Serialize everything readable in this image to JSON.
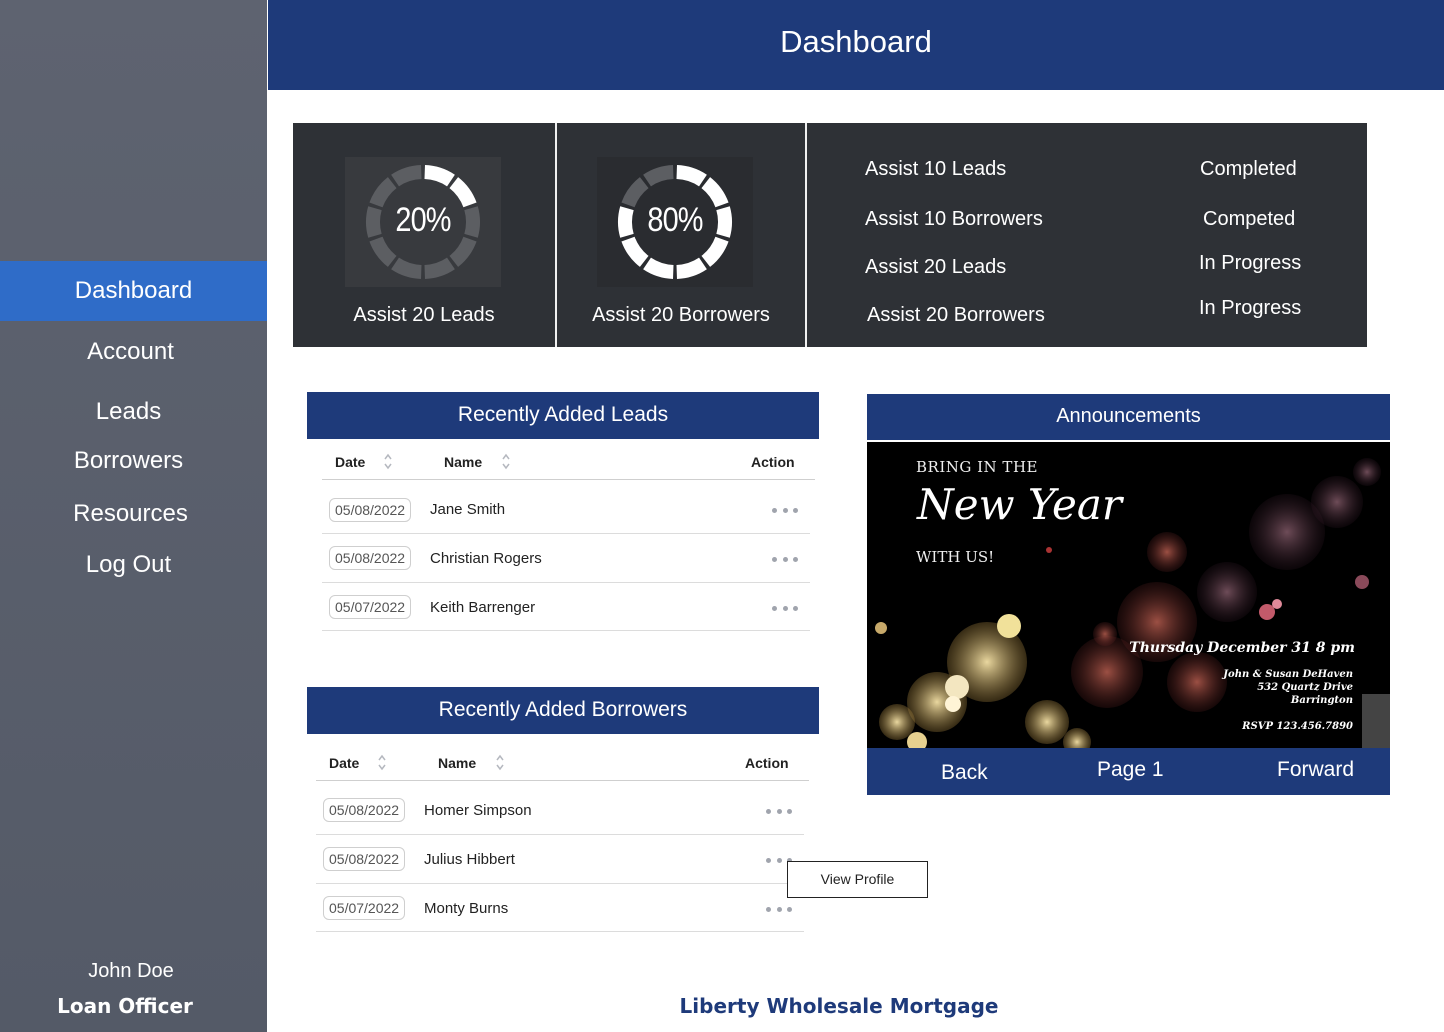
{
  "sidebar": {
    "items": [
      {
        "label": "Dashboard",
        "active": true
      },
      {
        "label": "Account"
      },
      {
        "label": "Leads"
      },
      {
        "label": "Borrowers"
      },
      {
        "label": "Resources"
      },
      {
        "label": "Log Out"
      }
    ],
    "user": {
      "name": "John Doe",
      "role": "Loan Officer"
    }
  },
  "header": {
    "title": "Dashboard"
  },
  "goals": {
    "rings": [
      {
        "percent": "20%",
        "value": 0.2,
        "label": "Assist 20 Leads"
      },
      {
        "percent": "80%",
        "value": 0.8,
        "label": "Assist 20 Borrowers"
      }
    ],
    "tasks": [
      {
        "name": "Assist 10 Leads",
        "status": "Completed"
      },
      {
        "name": "Assist 10 Borrowers",
        "status": "Competed"
      },
      {
        "name": "Assist 20 Leads",
        "status": "In Progress"
      },
      {
        "name": "Assist 20 Borrowers",
        "status": "In Progress"
      }
    ]
  },
  "leads_table": {
    "title": "Recently Added Leads",
    "columns": [
      "Date",
      "Name",
      "Action"
    ],
    "rows": [
      {
        "date": "05/08/2022",
        "name": "Jane Smith"
      },
      {
        "date": "05/08/2022",
        "name": "Christian Rogers"
      },
      {
        "date": "05/07/2022",
        "name": "Keith Barrenger"
      }
    ]
  },
  "borrowers_table": {
    "title": "Recently Added Borrowers",
    "columns": [
      "Date",
      "Name",
      "Action"
    ],
    "rows": [
      {
        "date": "05/08/2022",
        "name": "Homer Simpson"
      },
      {
        "date": "05/08/2022",
        "name": "Julius Hibbert"
      },
      {
        "date": "05/07/2022",
        "name": "Monty Burns"
      }
    ]
  },
  "context_menu": {
    "view_profile": "View Profile"
  },
  "announcements": {
    "title": "Announcements",
    "flyer": {
      "line1": "BRING IN THE",
      "script": "New Year",
      "line2": "WITH US!",
      "when": "Thursday  December 31  8 pm",
      "host": "John & Susan DeHaven",
      "address1": "532 Quartz Drive",
      "address2": "Barrington",
      "rsvp": "RSVP 123.456.7890"
    },
    "back": "Back",
    "page": "Page 1",
    "forward": "Forward"
  },
  "footer": {
    "brand": "Liberty Wholesale Mortgage"
  },
  "colors": {
    "navy": "#1e3a7a",
    "active_blue": "#2f6cc8",
    "sidebar": "#565c69",
    "panel": "#2e3136"
  }
}
